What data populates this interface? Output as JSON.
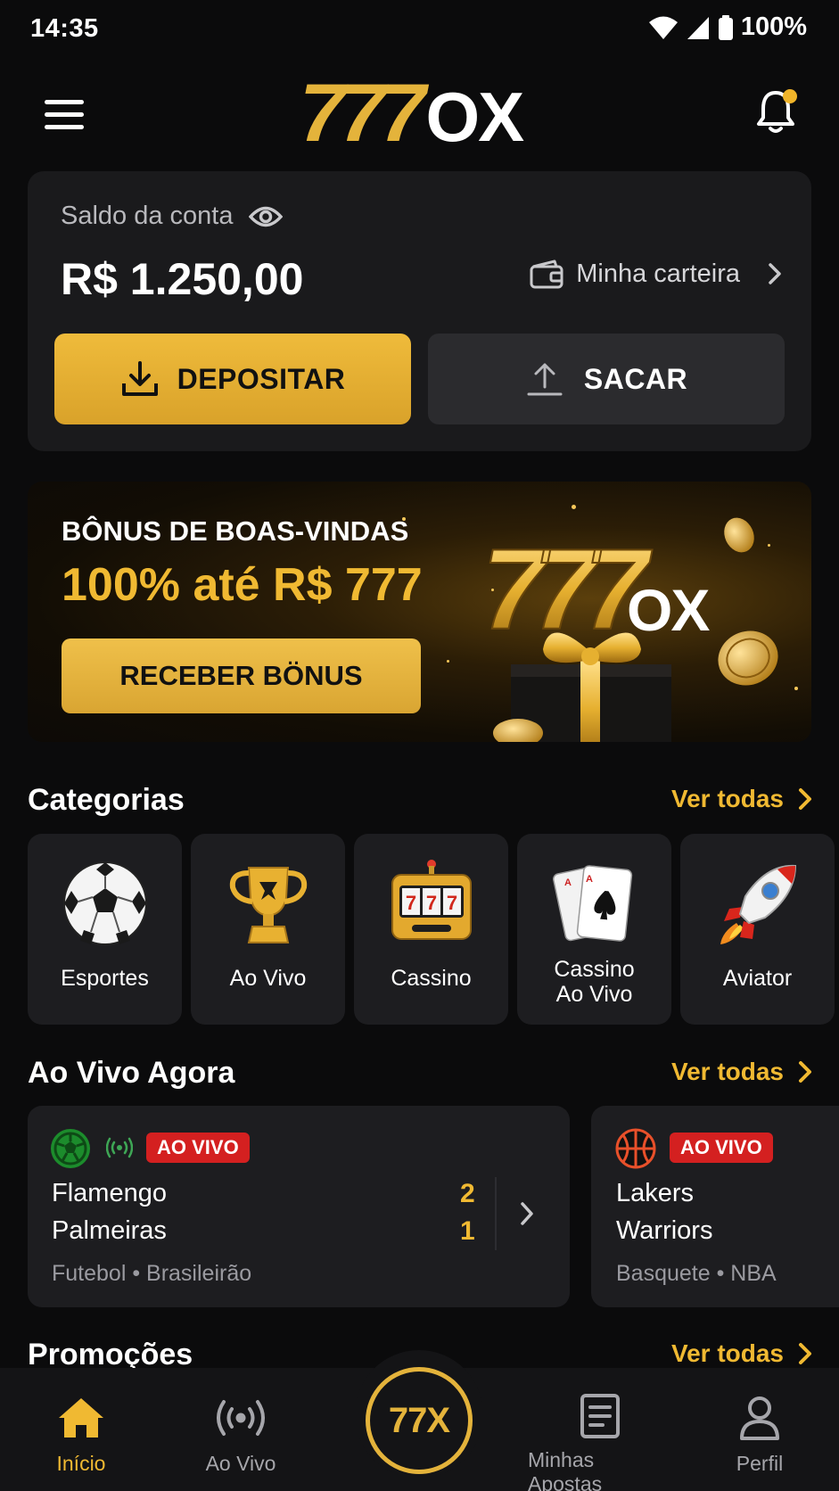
{
  "status_bar": {
    "time": "14:35",
    "battery": "100%"
  },
  "header": {
    "logo_primary": "777",
    "logo_secondary": "OX"
  },
  "balance": {
    "label": "Saldo da conta",
    "amount": "R$ 1.250,00",
    "wallet_link": "Minha carteira",
    "deposit_label": "DEPOSITAR",
    "withdraw_label": "SACAR"
  },
  "banner": {
    "title": "BÔNUS DE BOAS-VINDAS",
    "highlight": "100% até R$ 777",
    "button": "RECEBER BÖNUS",
    "art_logo_primary": "777",
    "art_logo_secondary": "OX"
  },
  "categories": {
    "title": "Categorias",
    "see_all": "Ver todas",
    "items": [
      {
        "label": "Esportes",
        "icon": "soccer-ball-icon"
      },
      {
        "label": "Ao Vivo",
        "icon": "trophy-icon"
      },
      {
        "label": "Cassino",
        "icon": "slot-machine-icon"
      },
      {
        "label": "Cassino",
        "label2": "Ao Vivo",
        "icon": "playing-cards-icon"
      },
      {
        "label": "Aviator",
        "icon": "rocket-icon"
      }
    ]
  },
  "live": {
    "title": "Ao Vivo Agora",
    "see_all": "Ver todas",
    "matches": [
      {
        "badge": "AO VIVO",
        "home": "Flamengo",
        "away": "Palmeiras",
        "home_score": "2",
        "away_score": "1",
        "league": "Futebol • Brasileirão",
        "sport_icon": "soccer-icon"
      },
      {
        "badge": "AO VIVO",
        "home": "Lakers",
        "away": "Warriors",
        "league": "Basquete • NBA",
        "sport_icon": "basketball-icon"
      }
    ]
  },
  "promos": {
    "title": "Promoções",
    "see_all": "Ver todas"
  },
  "nav": {
    "items": [
      {
        "label": "Início",
        "icon": "home-icon"
      },
      {
        "label": "Ao Vivo",
        "icon": "broadcast-icon"
      },
      {
        "label": "Minhas Apostas",
        "icon": "bets-list-icon"
      },
      {
        "label": "Perfil",
        "icon": "profile-icon"
      }
    ],
    "center_label": "77X"
  },
  "colors": {
    "accent": "#f0b932",
    "background": "#0b0b0c",
    "card": "#1d1d20",
    "live_red": "#d42020"
  }
}
